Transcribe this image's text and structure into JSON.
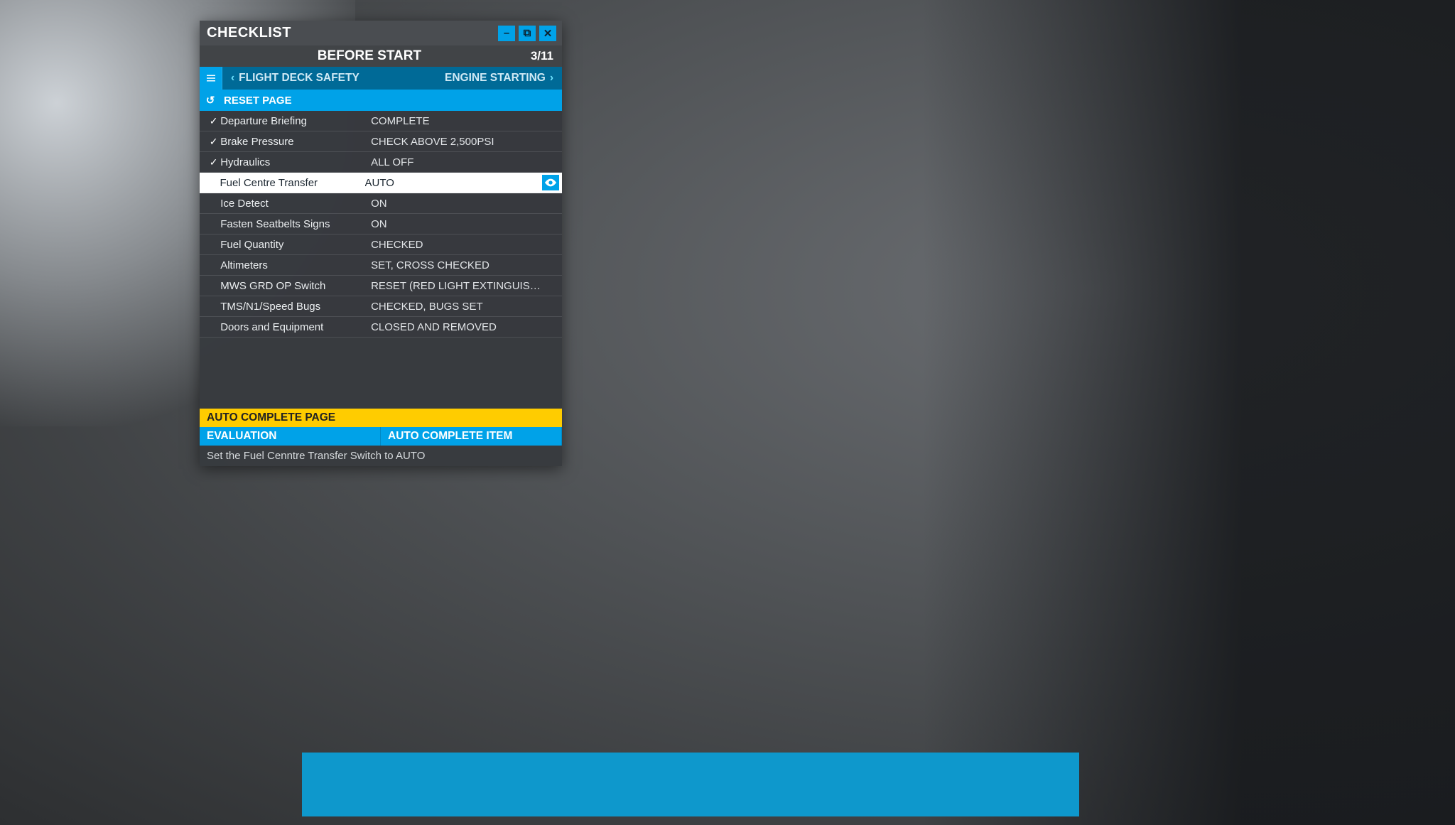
{
  "panel": {
    "title": "CHECKLIST",
    "phase": "BEFORE START",
    "phase_counter": "3/11",
    "prev_phase": "FLIGHT DECK SAFETY",
    "next_phase": "ENGINE STARTING",
    "reset_label": "RESET PAGE",
    "auto_complete_page": "AUTO COMPLETE PAGE",
    "evaluation_label": "EVALUATION",
    "auto_complete_item": "AUTO COMPLETE ITEM",
    "hint": "Set the Fuel Cenntre Transfer Switch to AUTO"
  },
  "items": [
    {
      "name": "Departure Briefing",
      "state": "COMPLETE",
      "checked": true,
      "selected": false
    },
    {
      "name": "Brake Pressure",
      "state": "CHECK ABOVE 2,500PSI",
      "checked": true,
      "selected": false
    },
    {
      "name": "Hydraulics",
      "state": "ALL OFF",
      "checked": true,
      "selected": false
    },
    {
      "name": "Fuel Centre Transfer",
      "state": "AUTO",
      "checked": false,
      "selected": true
    },
    {
      "name": "Ice Detect",
      "state": "ON",
      "checked": false,
      "selected": false
    },
    {
      "name": "Fasten Seatbelts Signs",
      "state": "ON",
      "checked": false,
      "selected": false
    },
    {
      "name": "Fuel Quantity",
      "state": "CHECKED",
      "checked": false,
      "selected": false
    },
    {
      "name": "Altimeters",
      "state": "SET, CROSS CHECKED",
      "checked": false,
      "selected": false
    },
    {
      "name": "MWS GRD OP Switch",
      "state": "RESET (RED LIGHT EXTINGUIS…",
      "checked": false,
      "selected": false
    },
    {
      "name": "TMS/N1/Speed Bugs",
      "state": "CHECKED, BUGS SET",
      "checked": false,
      "selected": false
    },
    {
      "name": "Doors and Equipment",
      "state": "CLOSED AND REMOVED",
      "checked": false,
      "selected": false
    }
  ],
  "colors": {
    "accent": "#00a2e8",
    "accent_dark": "#006a97",
    "warn": "#ffcc00"
  }
}
